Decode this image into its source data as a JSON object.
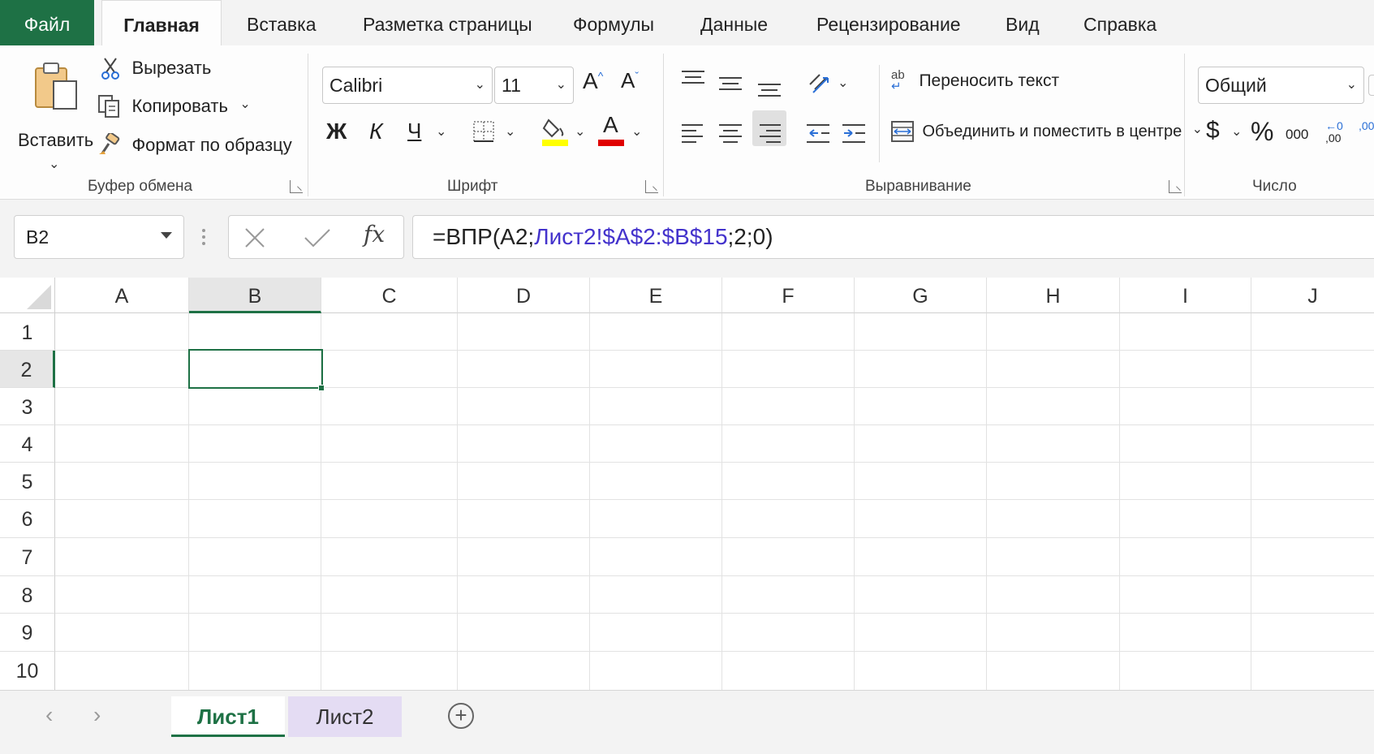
{
  "tabs": {
    "file": "Файл",
    "items": [
      "Главная",
      "Вставка",
      "Разметка страницы",
      "Формулы",
      "Данные",
      "Рецензирование",
      "Вид",
      "Справка"
    ],
    "active": "Главная"
  },
  "clipboard": {
    "paste": "Вставить",
    "cut": "Вырезать",
    "copy": "Копировать",
    "format_painter": "Формат по образцу",
    "group_label": "Буфер обмена"
  },
  "font": {
    "name": "Calibri",
    "size": "11",
    "grow": "A",
    "shrink": "A",
    "bold": "Ж",
    "italic": "К",
    "underline": "Ч",
    "font_color_letter": "A",
    "highlight_color": "#ffff00",
    "font_color": "#e00000",
    "group_label": "Шрифт"
  },
  "alignment": {
    "wrap_text": "Переносить текст",
    "merge_center": "Объединить и поместить в центре",
    "wrap_icon_text": "ab",
    "group_label": "Выравнивание"
  },
  "number": {
    "format": "Общий",
    "currency": "$",
    "percent": "%",
    "thousands": "000",
    "inc_decimal_top": "←0",
    "inc_decimal_bottom": ",00",
    "dec_decimal_top": ",00",
    "group_label": "Число"
  },
  "formula_bar": {
    "name_box": "B2",
    "fx": "fx",
    "formula_prefix": "=ВПР(A2;",
    "formula_ref": "Лист2!$A$2:$B$15",
    "formula_suffix": ";2;0)",
    "ref_color": "#4433cc"
  },
  "grid": {
    "columns": [
      "A",
      "B",
      "C",
      "D",
      "E",
      "F",
      "G",
      "H",
      "I",
      "J"
    ],
    "rows": [
      "1",
      "2",
      "3",
      "4",
      "5",
      "6",
      "7",
      "8",
      "9",
      "10"
    ],
    "selected_column": "B",
    "selected_row": "2"
  },
  "sheets": {
    "items": [
      "Лист1",
      "Лист2"
    ],
    "active": "Лист1",
    "prev": "‹",
    "next": "›",
    "add": "+"
  },
  "colors": {
    "accent": "#1e7145",
    "sheet2_tab": "#e4dcf3"
  }
}
